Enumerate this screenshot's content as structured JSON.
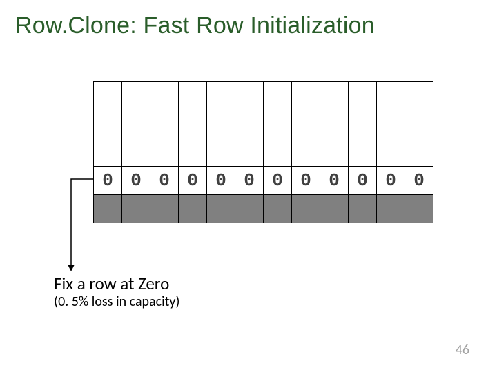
{
  "slide": {
    "title": "Row.Clone: Fast Row Initialization",
    "caption_line1": "Fix a row at Zero",
    "caption_line2": "(0. 5% loss in capacity)",
    "page_number": "46"
  },
  "chart_data": {
    "type": "table",
    "title": "DRAM row grid with fixed zero row",
    "columns": 12,
    "rows": [
      {
        "kind": "empty",
        "cells": [
          "",
          "",
          "",
          "",
          "",
          "",
          "",
          "",
          "",
          "",
          "",
          ""
        ]
      },
      {
        "kind": "empty",
        "cells": [
          "",
          "",
          "",
          "",
          "",
          "",
          "",
          "",
          "",
          "",
          "",
          ""
        ]
      },
      {
        "kind": "empty",
        "cells": [
          "",
          "",
          "",
          "",
          "",
          "",
          "",
          "",
          "",
          "",
          "",
          ""
        ]
      },
      {
        "kind": "zero",
        "cells": [
          "0",
          "0",
          "0",
          "0",
          "0",
          "0",
          "0",
          "0",
          "0",
          "0",
          "0",
          "0"
        ]
      },
      {
        "kind": "shaded",
        "cells": [
          "",
          "",
          "",
          "",
          "",
          "",
          "",
          "",
          "",
          "",
          "",
          ""
        ]
      }
    ],
    "arrow": {
      "from_row_index": 3,
      "label_target": "Fix a row at Zero"
    }
  }
}
